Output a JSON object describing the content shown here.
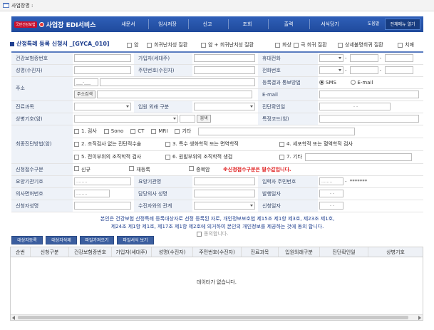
{
  "titlebar": {
    "text": "사업장명 :"
  },
  "header": {
    "logo_small": "국민건강보험",
    "logo_title": "사업장 EDI서비스",
    "menu": [
      "새문서",
      "임시저장",
      "신고",
      "조회",
      "출력",
      "서식당기"
    ],
    "help": "도움말",
    "all_menu": "전체메뉴 열기"
  },
  "form": {
    "title": "산정특례 등록 신청서 _[GYCA_010]",
    "disease_checks": [
      "암",
      "희귀난치성 질환",
      "암 + 희귀난치성 질환",
      "화상",
      "극 희귀 질환",
      "상세불명희귀 질환",
      "치매"
    ],
    "labels": {
      "insurance_no": "건강보험증번호",
      "householder": "가입자(세대주)",
      "mobile": "휴대전화",
      "name": "성명(수진자)",
      "rrn": "주민번호(수진자)",
      "phone": "전화번호",
      "address": "주소",
      "notify": "등록결과 통보방법",
      "email": "E-mail",
      "dept": "진료과목",
      "inout": "입원 외래 구분",
      "diag_date": "진단확인일",
      "disease_code": "상병기호(암)",
      "special_code": "특정코드(암)",
      "final_diag": "최종진단방법(암)",
      "apply_type": "신청접수구분",
      "institution": "요양기관기호",
      "institution_name": "요양기관명",
      "input_rrn": "입력자 주민번호",
      "doctor_license": "의사면허번호",
      "doctor_name": "담당의사 성명",
      "issue_date": "발행일자",
      "applicant": "신청자성명",
      "relation": "수진자와의 관계",
      "apply_date": "신청일자"
    },
    "address_btn": "주소검색",
    "zip_placeholder": "___-___",
    "notify_sms": "SMS",
    "notify_email": "E-mail",
    "search_btn": "검색",
    "date_placeholder": "- -",
    "exam_options": [
      "1. 검사",
      "Sono",
      "CT",
      "MRI",
      "기타",
      "2. 조직검사 없는 진단적수술",
      "3. 특수 생화학적 또는 면역학적",
      "4. 세포학적 또는 혈액학적 검사",
      "5. 전이부위의 조직학적 검사",
      "6. 원발부위의 조직학적 생검",
      "7. 기타"
    ],
    "apply_new": "신규",
    "apply_re": "재등록",
    "apply_dup": "중복암",
    "apply_required": "※신청접수구분은 필수값입니다.",
    "masked_rrn": "*******",
    "placeholder_dots": "........"
  },
  "notice": {
    "line1": "본인은 건강보험 산정특례 등록대상자로 선정 등록된 자로, 개인정보보호법 제15조 제1항 제3호, 제23조 제1호,",
    "line2": "제24조 제1항 제1호, 제17조 제1항 제2호에 의거하여 본인의 개인정보를 제공하는 것에 동의 합니다.",
    "agree": "동의합니다."
  },
  "buttons": [
    "대상자등록",
    "대상자삭제",
    "파일가져오기",
    "파일서식 보기"
  ],
  "grid": {
    "columns": [
      "순번",
      "신청구분",
      "건강보험증번호",
      "가입자(세대주)",
      "성명(수진자)",
      "주민번호(수진자)",
      "진료과목",
      "입원외래구분",
      "진단확인일",
      "상병기호"
    ],
    "empty": "데이타가 없습니다."
  },
  "colors": {
    "header_blue": "#2f5fb8",
    "accent_red": "#e02020",
    "title_blue": "#1f3f8f"
  }
}
